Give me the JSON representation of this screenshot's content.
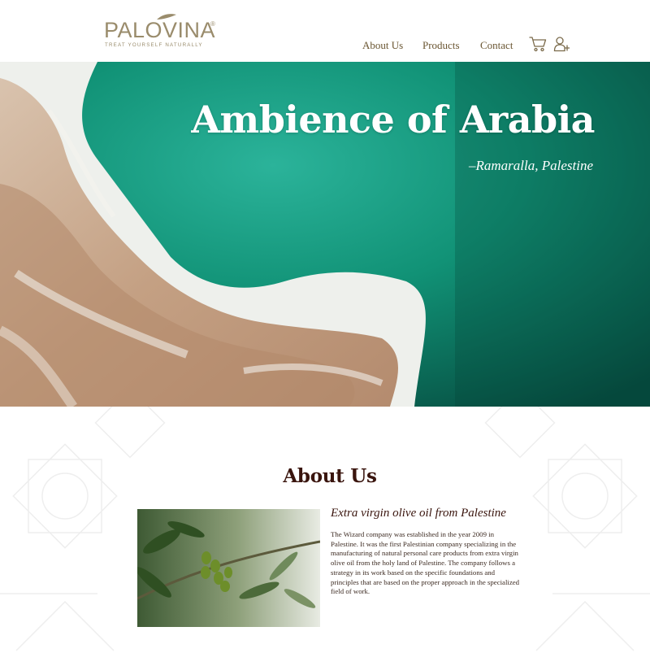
{
  "header": {
    "logo": {
      "brand": "PALOVINA",
      "registered": "®",
      "tagline": "TREAT YOURSELF NATURALLY",
      "color": "#9a8c6c"
    },
    "nav": [
      {
        "label": "About Us"
      },
      {
        "label": "Products"
      },
      {
        "label": "Contact"
      }
    ],
    "icons": [
      "cart-icon",
      "add-user-icon"
    ]
  },
  "hero": {
    "title": "Ambience of Arabia",
    "subtitle": "–Ramaralla, Palestine",
    "colors": {
      "sea": "#0f6e5c",
      "sand": "#c9a88e"
    }
  },
  "about": {
    "title": "About Us",
    "heading": "Extra virgin olive oil from Palestine",
    "body": "The Wizard company was established in the year 2009 in Palestine. It was the first Palestinian company specializing in the manufacturing of natural personal care products from extra virgin olive oil from the holy land of Palestine. The company follows a strategy in its work based on the specific foundations and principles that are based on the proper approach in the specialized field of work.",
    "title_color": "#3a150e"
  }
}
